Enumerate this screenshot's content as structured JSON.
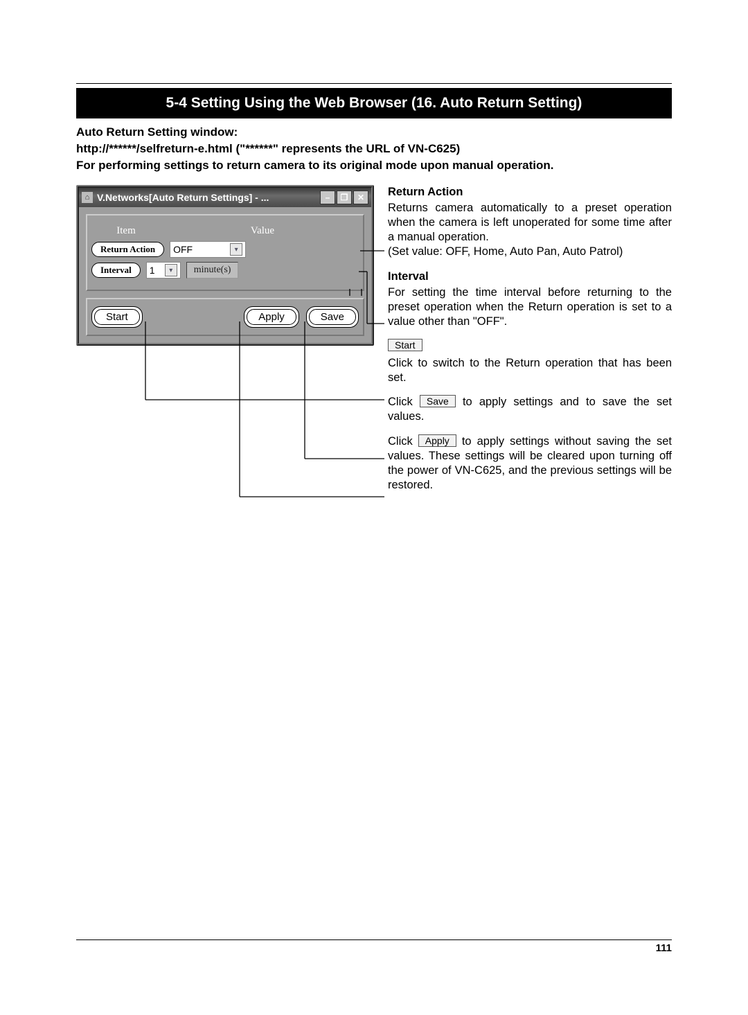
{
  "header": {
    "title": "5-4 Setting Using the Web Browser (16. Auto Return Setting)"
  },
  "intro": {
    "line1": "Auto Return Setting window:",
    "line2": "http://******/selfreturn-e.html (\"******\" represents the URL of VN-C625)",
    "line3": "For performing settings to return camera to its original mode upon manual operation."
  },
  "window": {
    "title": "V.Networks[Auto Return Settings] - ...",
    "min_icon": "–",
    "max_icon": "❐",
    "close_icon": "✕",
    "col_item": "Item",
    "col_value": "Value",
    "return_action_label": "Return Action",
    "return_action_value": "OFF",
    "interval_label": "Interval",
    "interval_value": "1",
    "interval_unit": "minute(s)",
    "start": "Start",
    "apply": "Apply",
    "save": "Save"
  },
  "explain": {
    "ra_head": "Return Action",
    "ra_body1": "Returns camera automatically to a preset operation when the camera is left unoperated for some time after a manual operation.",
    "ra_body2": "(Set value: OFF, Home, Auto Pan, Auto Patrol)",
    "iv_head": "Interval",
    "iv_body": "For setting the time interval before returning to the preset operation when the Return operation is set to a value other than \"OFF\".",
    "start_btn": "Start",
    "start_body": "Click to switch to the Return operation that has been set.",
    "save_btn": "Save",
    "save_pre": "Click ",
    "save_post": " to apply settings and to save the set values.",
    "apply_btn": "Apply",
    "apply_pre": "Click ",
    "apply_post": " to apply settings without saving the set values. These settings will be cleared upon turning off the power of VN-C625, and the previous settings will be restored."
  },
  "page_number": "111"
}
